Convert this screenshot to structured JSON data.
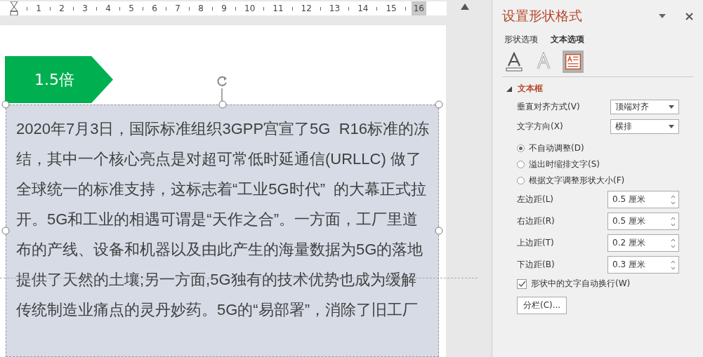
{
  "ruler": {
    "labels": [
      "1",
      "2",
      "3",
      "4",
      "5",
      "6",
      "7",
      "8",
      "9",
      "10",
      "11",
      "12",
      "13",
      "14",
      "15",
      "16"
    ]
  },
  "slide": {
    "tag": {
      "label": "1.5倍"
    },
    "text_box": {
      "text": "2020年7月3日，国际标准组织3GPP宫宣了5G  R16标准的冻结，其中一个核心亮点是对超可常低时延通信(URLLC) 做了全球统一的标准支持，这标志着“工业5G时代”  的大幕正式拉开。5G和工业的相遇可谓是“天作之合”。一方面，工厂里道布的产线、设备和机器以及由此产生的海量数据为5G的落地提供了天然的土壤;另一方面,5G独有的技术优势也成为缓解传统制造业痛点的灵丹妙药。5G的“易部署”，消除了旧工厂",
      "selected": true
    }
  },
  "panel": {
    "title": "设置形状格式",
    "tabs": [
      {
        "label": "形状选项",
        "selected": false
      },
      {
        "label": "文本选项",
        "selected": true
      }
    ],
    "icon_tabs": [
      {
        "kind": "fill",
        "selected": false
      },
      {
        "kind": "outline",
        "selected": false
      },
      {
        "kind": "textbox",
        "selected": true
      }
    ],
    "section": {
      "title": "文本框",
      "expanded": true
    },
    "dropdowns": [
      {
        "label": "垂直对齐方式(V)",
        "value": "顶端对齐"
      },
      {
        "label": "文字方向(X)",
        "value": "横排"
      }
    ],
    "radios": [
      {
        "label": "不自动调整(D)",
        "selected": true
      },
      {
        "label": "溢出时缩排文字(S)",
        "selected": false
      },
      {
        "label": "根据文字调整形状大小(F)",
        "selected": false
      }
    ],
    "spinners": [
      {
        "label": "左边距(L)",
        "value": "0.5 厘米"
      },
      {
        "label": "右边距(R)",
        "value": "0.5 厘米"
      },
      {
        "label": "上边距(T)",
        "value": "0.2 厘米"
      },
      {
        "label": "下边距(B)",
        "value": "0.3 厘米"
      }
    ],
    "wrap_checkbox": {
      "label": "形状中的文字自动换行(W)",
      "checked": true
    },
    "columns_button": {
      "label": "分栏(C)..."
    }
  }
}
